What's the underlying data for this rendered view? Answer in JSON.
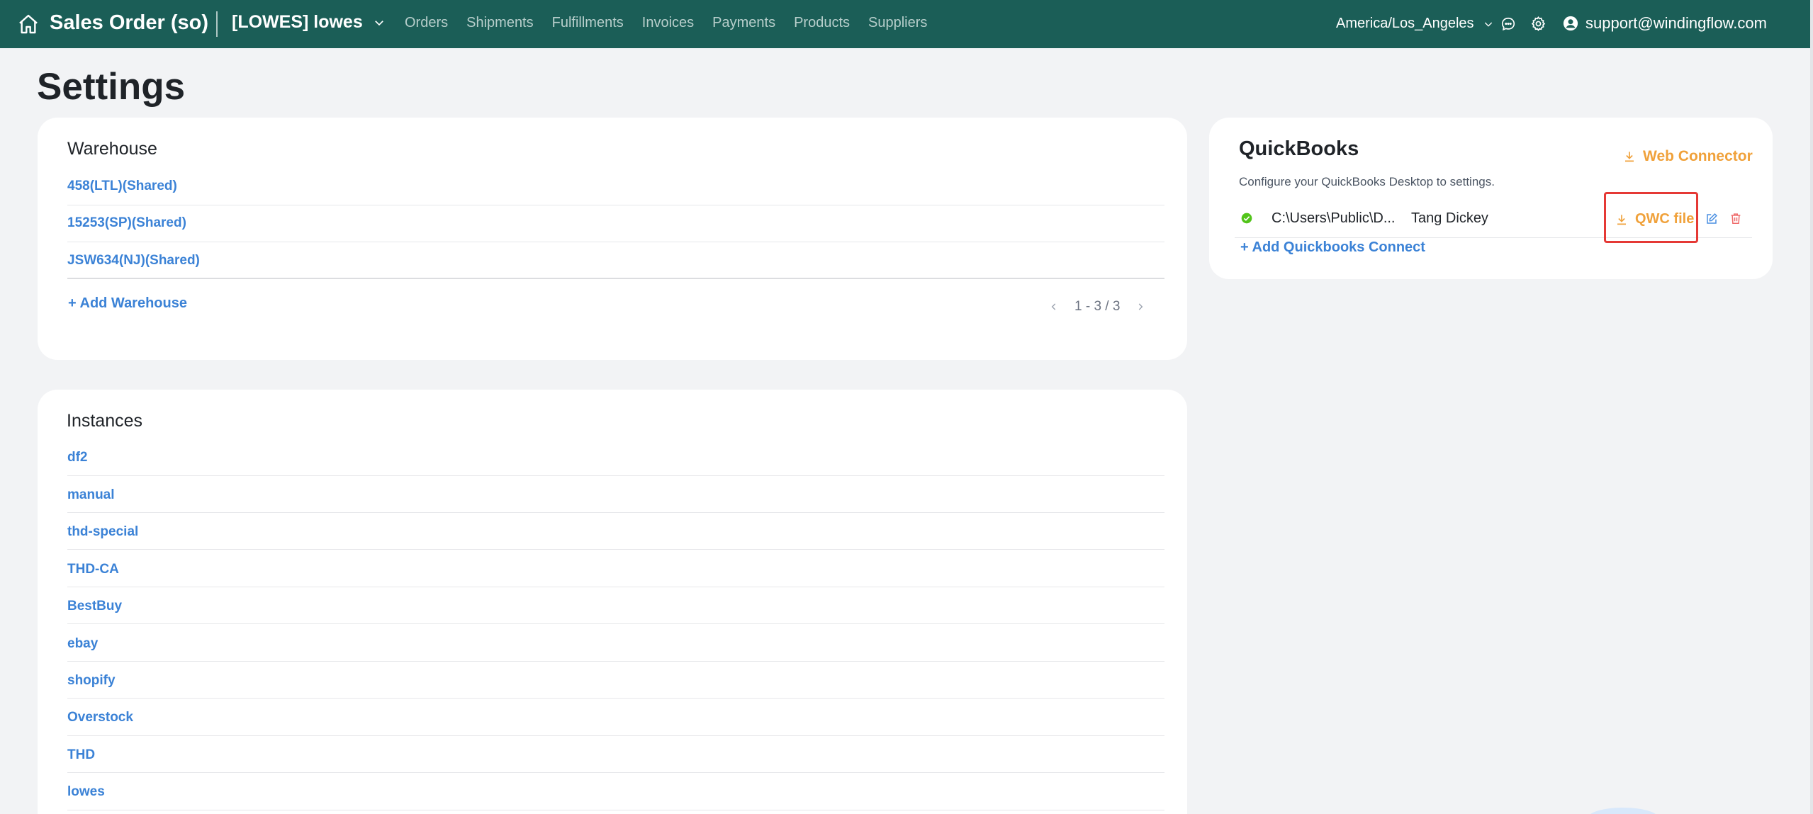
{
  "header": {
    "app_title": "Sales Order (so)",
    "store": "[LOWES] lowes",
    "nav": [
      "Orders",
      "Shipments",
      "Fulfillments",
      "Invoices",
      "Payments",
      "Products",
      "Suppliers"
    ],
    "timezone": "America/Los_Angeles",
    "user_email": "support@windingflow.com",
    "bar_color": "#1b5e57"
  },
  "page": {
    "title": "Settings"
  },
  "warehouse": {
    "title": "Warehouse",
    "items": [
      "458(LTL)(Shared)",
      "15253(SP)(Shared)",
      "JSW634(NJ)(Shared)"
    ],
    "add_label": "+ Add Warehouse",
    "pagination": "1 - 3 / 3"
  },
  "instances": {
    "title": "Instances",
    "items": [
      "df2",
      "manual",
      "thd-special",
      "THD-CA",
      "BestBuy",
      "ebay",
      "shopify",
      "Overstock",
      "THD",
      "lowes"
    ]
  },
  "quickbooks": {
    "title": "QuickBooks",
    "web_connector_label": "Web Connector",
    "description": "Configure your QuickBooks Desktop to settings.",
    "connection": {
      "path": "C:\\Users\\Public\\D...",
      "user": "Tang Dickey",
      "qwc_label": "QWC file"
    },
    "add_label": "+ Add Quickbooks Connect",
    "accent_color": "#f0a13a"
  }
}
